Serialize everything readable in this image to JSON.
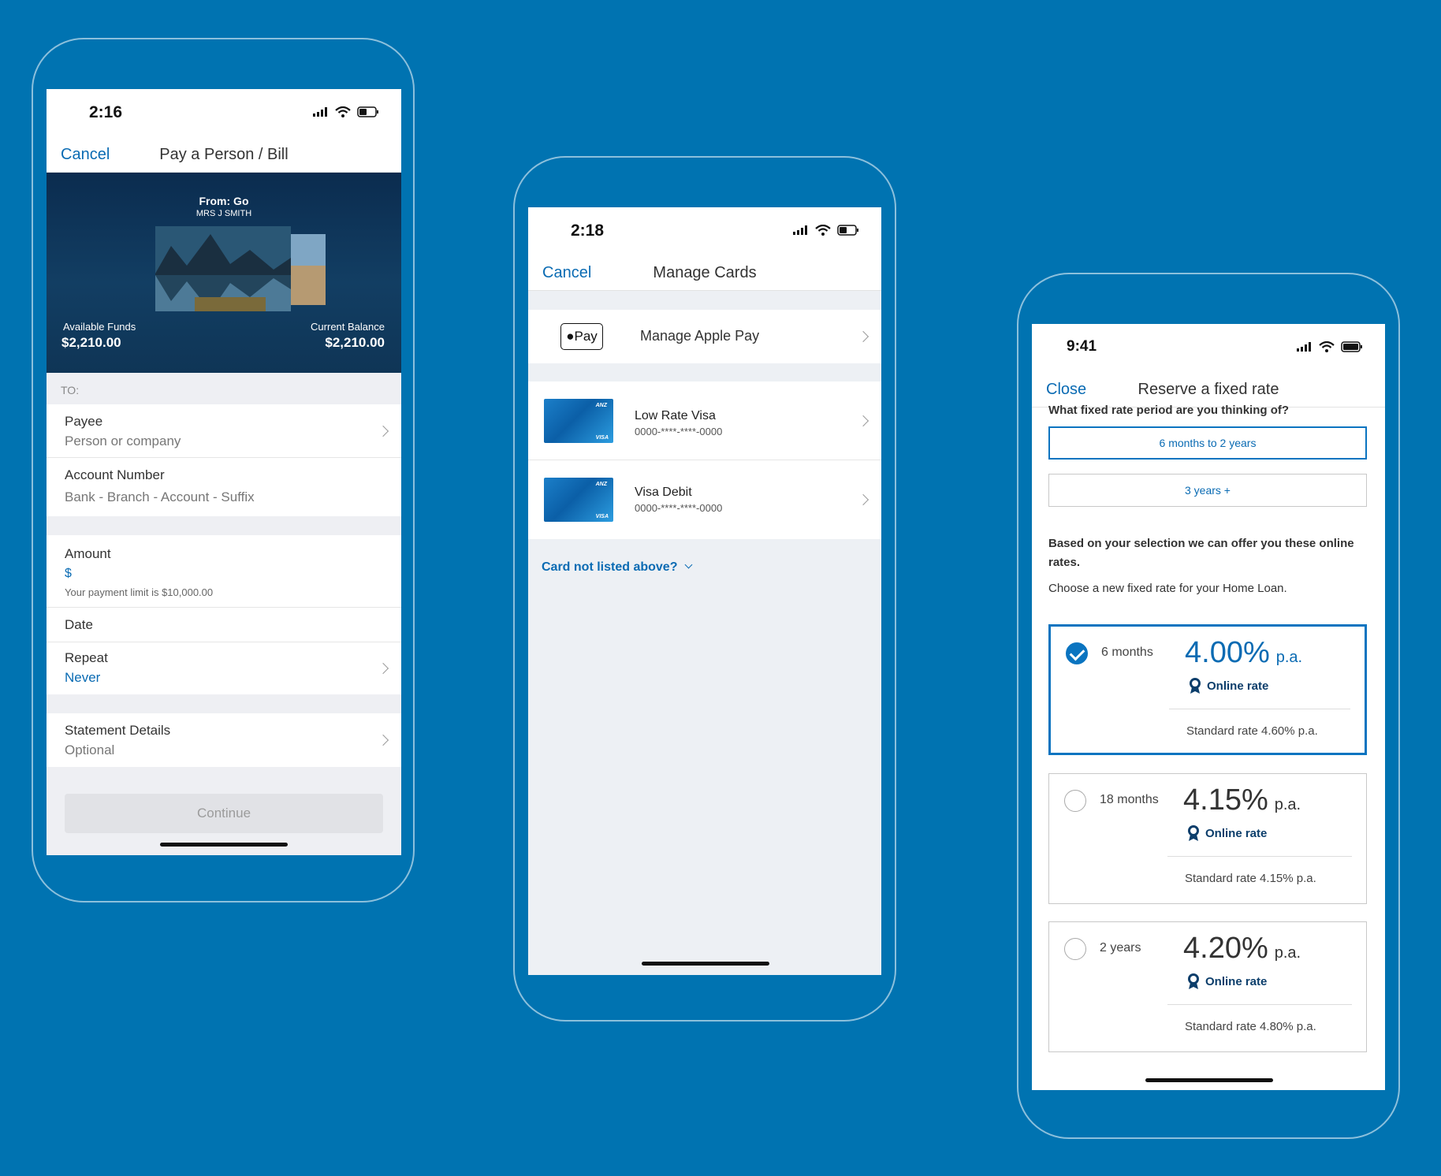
{
  "colors": {
    "background": "#0073b1",
    "accent": "#0a6bb3",
    "card_blue": "#0a74c0"
  },
  "pay": {
    "time": "2:16",
    "cancel": "Cancel",
    "title": "Pay a Person / Bill",
    "from": "From: Go",
    "holder": "MRS J SMITH",
    "available_label": "Available Funds",
    "available_value": "$2,210.00",
    "current_label": "Current Balance",
    "current_value": "$2,210.00",
    "to_label": "TO:",
    "payee_label": "Payee",
    "payee_placeholder": "Person or company",
    "account_label": "Account Number",
    "account_placeholder": "Bank - Branch - Account - Suffix",
    "amount_label": "Amount",
    "amount_symbol": "$",
    "amount_hint": "Your payment limit is $10,000.00",
    "date_label": "Date",
    "repeat_label": "Repeat",
    "repeat_value": "Never",
    "statement_label": "Statement Details",
    "statement_value": "Optional",
    "continue": "Continue"
  },
  "cards": {
    "time": "2:18",
    "cancel": "Cancel",
    "title": "Manage Cards",
    "applepay_badge": "Pay",
    "applepay_label": "Manage Apple Pay",
    "items": [
      {
        "name": "Low Rate Visa",
        "number": "0000-****-****-0000",
        "brand": "ANZ",
        "network": "VISA"
      },
      {
        "name": "Visa Debit",
        "number": "0000-****-****-0000",
        "brand": "ANZ",
        "network": "VISA"
      }
    ],
    "not_listed": "Card not listed above?"
  },
  "fixed": {
    "time": "9:41",
    "close": "Close",
    "title": "Reserve a fixed rate",
    "question": "What fixed rate period are you thinking of?",
    "segments": [
      "6 months to 2 years",
      "3 years +"
    ],
    "selected_segment": "6 months to 2 years",
    "based_text": "Based on your selection we can offer you these online rates.",
    "choose_text": "Choose a new fixed rate for your Home Loan.",
    "rates": [
      {
        "period": "6 months",
        "rate": "4.00%",
        "pa": "p.a.",
        "online": "Online rate",
        "standard": "Standard rate 4.60% p.a.",
        "selected": true
      },
      {
        "period": "18 months",
        "rate": "4.15%",
        "pa": "p.a.",
        "online": "Online rate",
        "standard": "Standard rate 4.15% p.a.",
        "selected": false
      },
      {
        "period": "2 years",
        "rate": "4.20%",
        "pa": "p.a.",
        "online": "Online rate",
        "standard": "Standard rate 4.80% p.a.",
        "selected": false
      }
    ]
  }
}
